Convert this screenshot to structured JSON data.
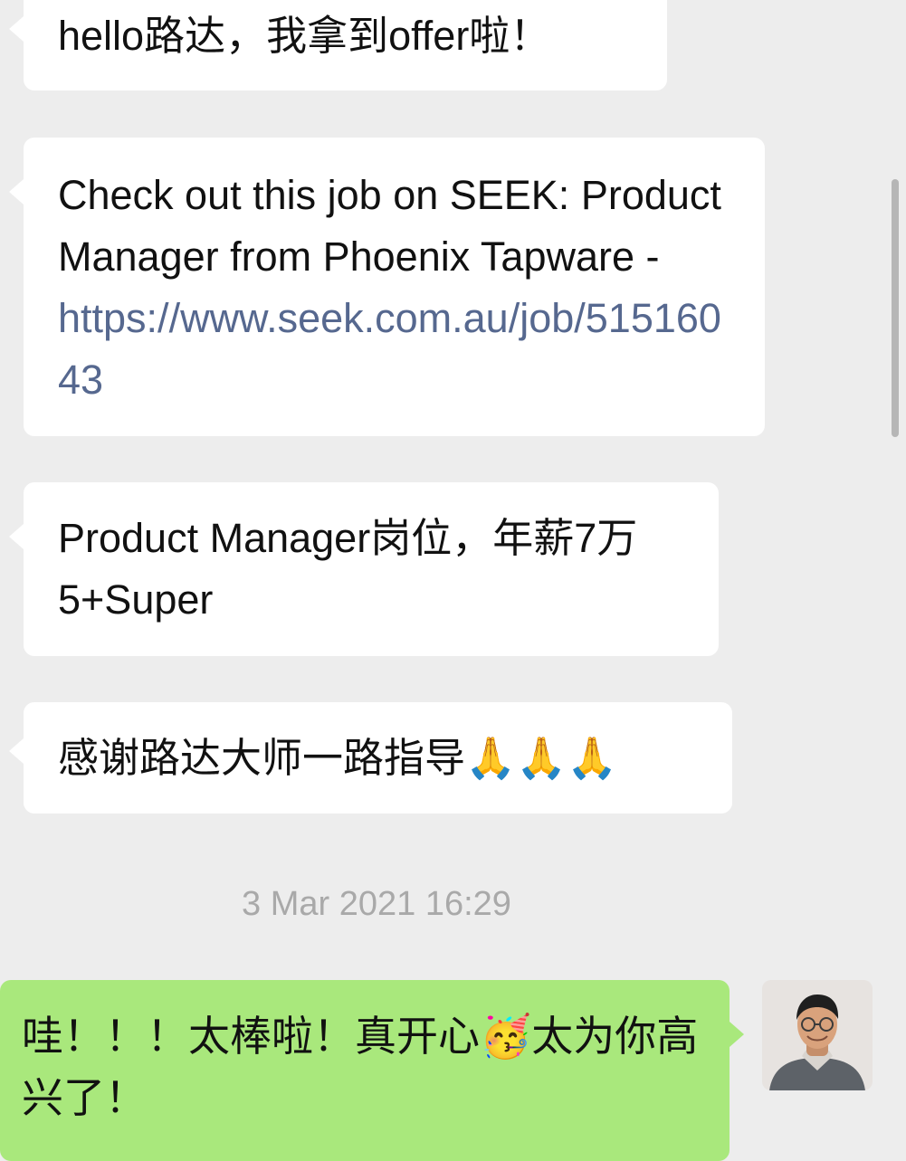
{
  "messages": [
    {
      "text": "hello路达，我拿到offer啦！"
    },
    {
      "text_before_link": "Check out this job on SEEK: Product Manager from Phoenix Tapware - ",
      "link": "https://www.seek.com.au/job/51516043"
    },
    {
      "text": "Product Manager岗位，年薪7万5+Super"
    },
    {
      "text": "感谢路达大师一路指导🙏🙏🙏"
    }
  ],
  "timestamp": "3 Mar 2021 16:29",
  "reply": {
    "text": "哇！！！太棒啦！真开心🥳太为你高兴了！"
  },
  "colors": {
    "background": "#ededed",
    "incoming_bubble": "#ffffff",
    "outgoing_bubble": "#a9e87c",
    "link": "#56688f",
    "timestamp": "#a9a9a9"
  },
  "icons": {
    "avatar": "user-avatar-photo"
  }
}
